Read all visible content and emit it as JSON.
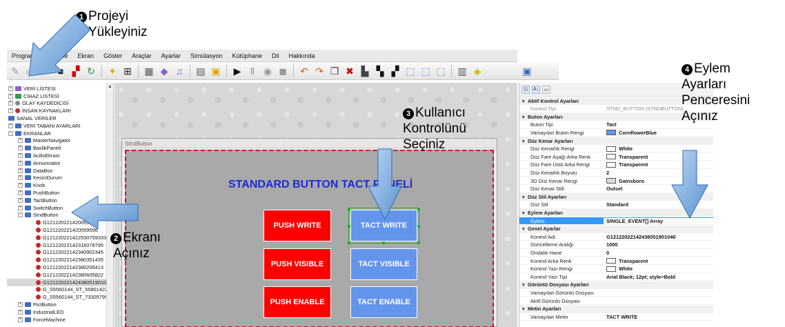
{
  "menu": [
    "Program",
    "Düzenle",
    "Ekran",
    "Göster",
    "Araçlar",
    "Ayarlar",
    "Simülasyon",
    "Kütüphane",
    "Dil",
    "Hakkında"
  ],
  "tree": {
    "top_items": [
      "VERİ LİSTESİ",
      "CİHAZ LİSTESİ",
      "OLAY KAYDEDİCİSİ",
      "İNSAN KAYNAKLARI",
      "SANAL VERİLER",
      "VERİ TABANI AYARLARI",
      "EKRANLAR"
    ],
    "screens": [
      "MasterNavigator",
      "BaslikPaneli",
      "AcilisEkrani",
      "Annunciator",
      "DataBox",
      "KesiciDurum",
      "Knob",
      "PushButton",
      "TactButton",
      "SwitchButton",
      "StndButton"
    ],
    "children": [
      "G121220221420059596",
      "G121220221420059596",
      "G121220221422530759333",
      "G12122022142316078795",
      "G12122022142340902345",
      "G12122022142380351435",
      "G12122022142380206413",
      "G12122022142380605822",
      "G121220221424380519010",
      "G_S5560144_ST_55801422",
      "G_S5560144_ST_73305799"
    ],
    "child_first": "G121220221",
    "more_screens": [
      "PictButton",
      "IndustrialLED",
      "ForceMachine"
    ]
  },
  "form": {
    "window_title": "StndButton",
    "panel_title": "STANDARD BUTTON TACT PANELİ",
    "buttons": {
      "push_write": "PUSH WRITE",
      "tact_write": "TACT WRITE",
      "push_visible": "PUSH VISIBLE",
      "tact_visible": "TACT VISIBLE",
      "push_enable": "PUSH ENABLE",
      "tact_enable": "TACT ENABLE"
    }
  },
  "props": {
    "rows": [
      {
        "type": "cat",
        "label": "Aktif Kontrol Ayarları"
      },
      {
        "type": "gray",
        "label": "Kontrol Tipi",
        "value": "STND_BUTTON (STNDBUTTON)"
      },
      {
        "type": "cat",
        "label": "Buton Ayarları"
      },
      {
        "type": "row",
        "label": "Buton Tipi",
        "value": "Tact"
      },
      {
        "type": "row",
        "label": "Varsayılan Buton Rengi",
        "value": "CornflowerBlue",
        "color": "#6495ed"
      },
      {
        "type": "cat",
        "label": "Düz Kenar Ayarları"
      },
      {
        "type": "row",
        "label": "Düz Kenarlık Rengi",
        "value": "White",
        "color": "#ffffff"
      },
      {
        "type": "row",
        "label": "Düz Fare Aşağı Arka Renk",
        "value": "Transparent",
        "color": "#ffffff"
      },
      {
        "type": "row",
        "label": "Düz Fare Üstü Arka Rengi",
        "value": "Transparent",
        "color": "#ffffff"
      },
      {
        "type": "row",
        "label": "Düz Kenarlık Boyutu",
        "value": "2"
      },
      {
        "type": "row",
        "label": "3D Düz Kenar Rengi",
        "value": "Gainsboro",
        "color": "#dcdcdc"
      },
      {
        "type": "row",
        "label": "Düz Kenar Stili",
        "value": "Outset"
      },
      {
        "type": "cat",
        "label": "Düz Stil Ayarları"
      },
      {
        "type": "row",
        "label": "Düz Stil",
        "value": "Standard"
      },
      {
        "type": "cat",
        "label": "Eylem Ayarları"
      },
      {
        "type": "sel",
        "label": "Eylem",
        "value": "SINGLE_EVENT[] Array"
      },
      {
        "type": "cat",
        "label": "Genel Ayarlar"
      },
      {
        "type": "row",
        "label": "Kontrol Adı",
        "value": "G1212202214243805190104б"
      },
      {
        "type": "row",
        "label": "Güncelleme Aralığı",
        "value": "1000"
      },
      {
        "type": "row",
        "label": "Ondalık Hane",
        "value": "0"
      },
      {
        "type": "row",
        "label": "Kontrol Arka Renk",
        "value": "Transparent",
        "color": "#ffffff"
      },
      {
        "type": "row",
        "label": "Kontrol Yazı Rengi",
        "value": "White",
        "color": "#ffffff"
      },
      {
        "type": "row",
        "label": "Kontrol Yazı Tipi",
        "value": "Arial Black; 12pt; style=Bold"
      },
      {
        "type": "cat",
        "label": "Görüntü Dosyası Ayarları"
      },
      {
        "type": "row",
        "label": "Varsayılan Görüntü Dosyası",
        "value": ""
      },
      {
        "type": "row",
        "label": "Aktif Görüntü Dosyası",
        "value": ""
      },
      {
        "type": "cat",
        "label": "Metin Ayarları"
      },
      {
        "type": "row",
        "label": "Varsayılan Metin",
        "value": "TACT WRITE"
      }
    ]
  },
  "annotations": {
    "step1": {
      "num": "1",
      "lines": [
        "Projeyi",
        "Yükleyiniz"
      ]
    },
    "step2": {
      "num": "2",
      "lines": [
        "Ekranı",
        "Açınız"
      ]
    },
    "step3": {
      "num": "3",
      "lines": [
        "Kullanıcı",
        "Kontrolünü",
        "Seçiniz"
      ]
    },
    "step4": {
      "num": "4",
      "lines": [
        "Eylem",
        "Ayarları",
        "Penceresini",
        "Açınız"
      ]
    }
  },
  "colors": {
    "arrow": "#6fa8dc",
    "arrow_edge": "#2e6fb5",
    "push_red": "#ff0000",
    "tact_blue": "#6495ed",
    "title_blue": "#1b2bd8"
  }
}
